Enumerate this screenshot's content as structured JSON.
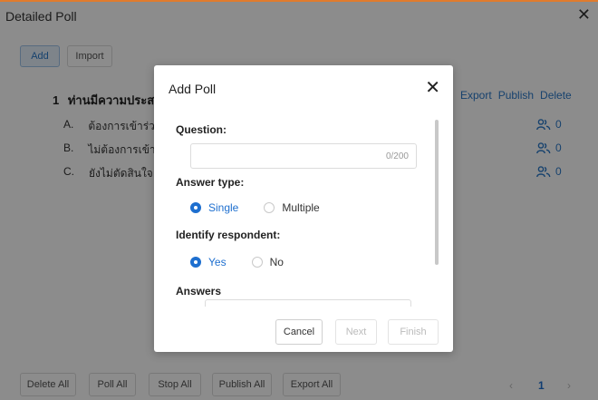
{
  "window": {
    "title": "Detailed Poll",
    "close_glyph": "✕"
  },
  "toolbar": {
    "add_label": "Add",
    "import_label": "Import"
  },
  "question": {
    "number": "1",
    "text": "ท่านมีความประส",
    "actions": [
      "Export",
      "Publish",
      "Delete"
    ]
  },
  "answers": [
    {
      "letter": "A.",
      "text": "ต้องการเข้าร่วม",
      "count": "0"
    },
    {
      "letter": "B.",
      "text": "ไม่ต้องการเข้าร่",
      "count": "0"
    },
    {
      "letter": "C.",
      "text": "ยังไม่ตัดสินใจ",
      "count": "0"
    }
  ],
  "bottom_bar": {
    "buttons": [
      "Delete All",
      "Poll All",
      "Stop All",
      "Publish All",
      "Export All"
    ],
    "pager": {
      "prev": "‹",
      "page": "1",
      "next": "›"
    }
  },
  "modal": {
    "title": "Add Poll",
    "close_glyph": "✕",
    "question_label": "Question:",
    "question_value": "",
    "question_counter": "0/200",
    "answer_type_label": "Answer type:",
    "answer_type_options": [
      "Single",
      "Multiple"
    ],
    "answer_type_selected": "Single",
    "identify_label": "Identify respondent:",
    "identify_options": [
      "Yes",
      "No"
    ],
    "identify_selected": "Yes",
    "answers_label": "Answers",
    "buttons": {
      "cancel": "Cancel",
      "next": "Next",
      "finish": "Finish"
    }
  },
  "colors": {
    "accent": "#1e6fcf",
    "link": "#2a78c8",
    "top_border": "#e07b2e"
  },
  "icons": {
    "respondent": "users-icon"
  }
}
